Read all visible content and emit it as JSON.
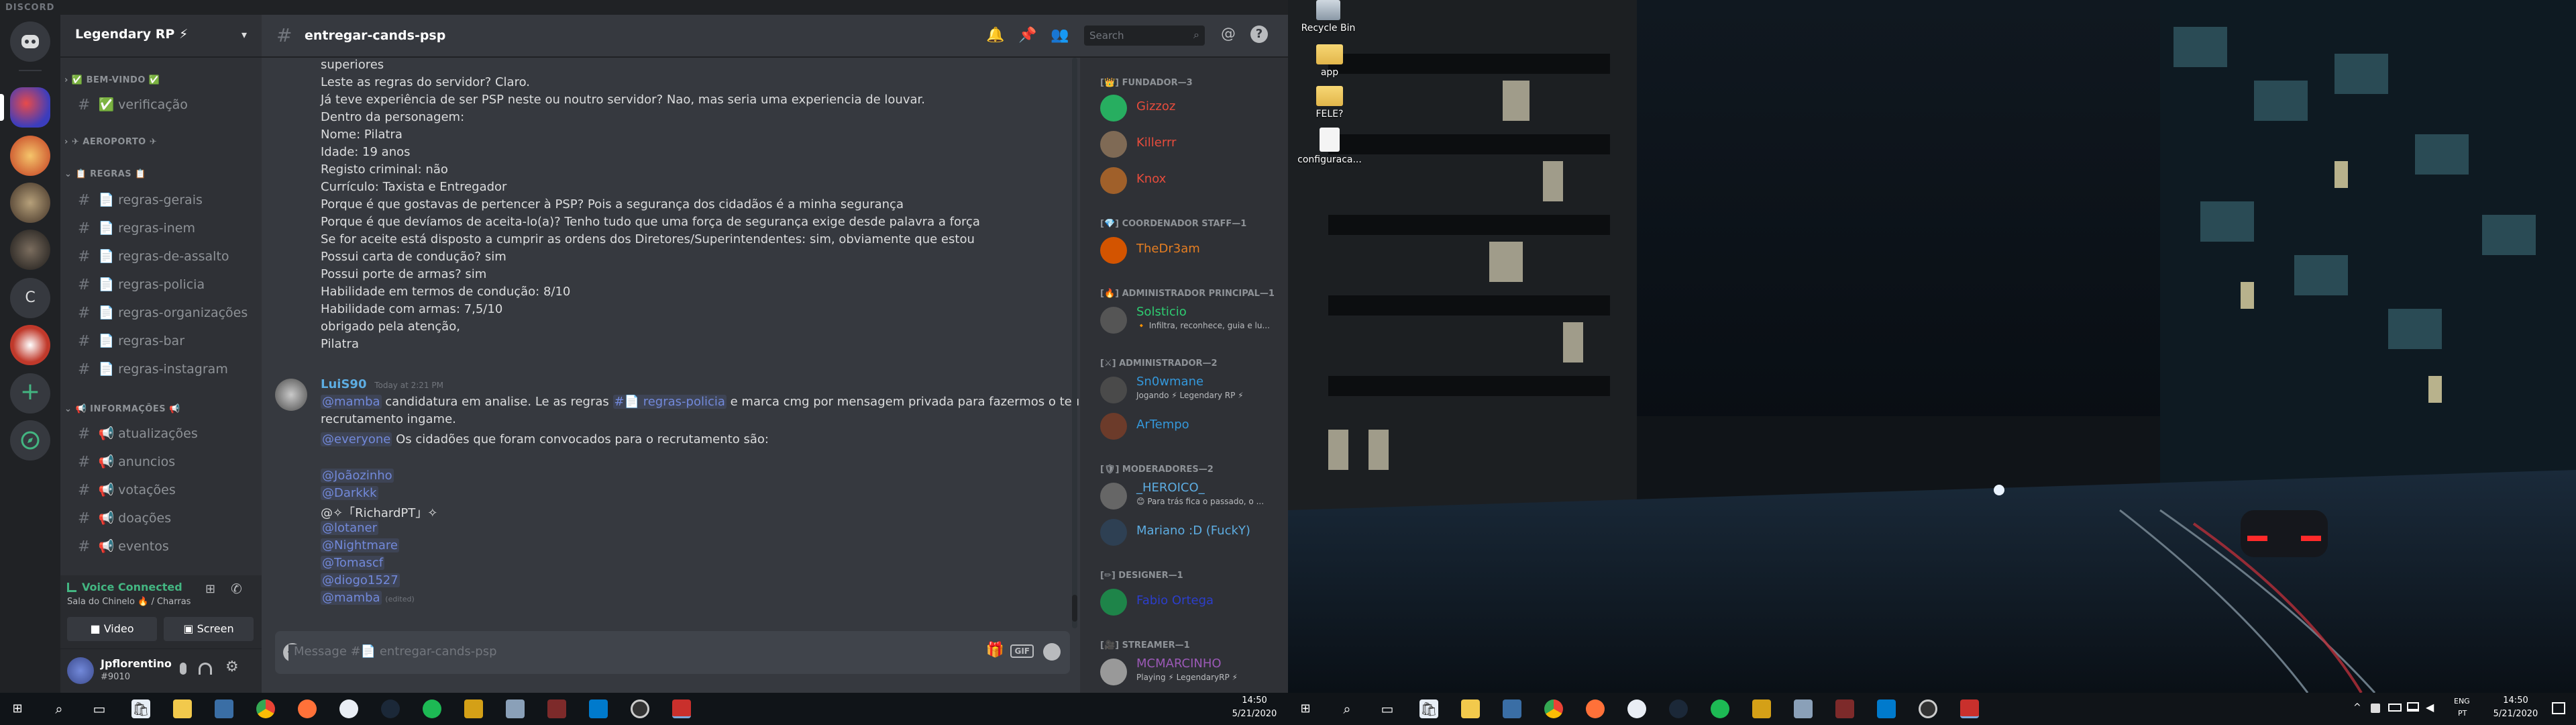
{
  "app": {
    "title": "DISCORD"
  },
  "server": {
    "name": "Legendary RP ⚡",
    "dropdown_icon": "chevron-down-icon"
  },
  "guild_letter": "C",
  "categories": [
    {
      "label": "✅ BEM-VINDO ✅"
    },
    {
      "label": "✈ AEROPORTO ✈"
    },
    {
      "label": "📋 REGRAS 📋"
    },
    {
      "label": "📢 INFORMAÇÕES 📢"
    }
  ],
  "channels": [
    {
      "label": "✅ verificação"
    },
    {
      "label": "📄 regras-gerais"
    },
    {
      "label": "📄 regras-inem"
    },
    {
      "label": "📄 regras-de-assalto"
    },
    {
      "label": "📄 regras-policia"
    },
    {
      "label": "📄 regras-organizações"
    },
    {
      "label": "📄 regras-bar"
    },
    {
      "label": "📄 regras-instagram"
    },
    {
      "label": "📢 atualizações"
    },
    {
      "label": "📢 anuncios"
    },
    {
      "label": "📢 votações"
    },
    {
      "label": "📢 doações"
    },
    {
      "label": "📢 eventos"
    }
  ],
  "voice": {
    "status": "Voice Connected",
    "location": "Sala do Chinelo 🔥 / Charras",
    "video_label": "Video",
    "screen_label": "Screen"
  },
  "user": {
    "name": "Jpflorentino",
    "tag": "#9010"
  },
  "chat": {
    "channel_name": "entregar-cands-psp",
    "search_placeholder": "Search",
    "composer_placeholder": "Message #📄 entregar-cands-psp"
  },
  "messages_prev": [
    "superiores",
    "Leste as regras do servidor? Claro.",
    "Já teve experiência de ser PSP neste ou noutro servidor? Nao, mas seria uma experiencia de louvar.",
    "Dentro da personagem:",
    "Nome: Pilatra",
    "Idade: 19 anos",
    "Registo criminal: não",
    "Currículo: Taxista e Entregador",
    "Porque é que gostavas de pertencer à PSP? Pois a segurança dos cidadãos é a minha segurança",
    "Porque é que devíamos de aceita-lo(a)? Tenho tudo que uma força de segurança exige desde palavra a força",
    "Se for aceite está disposto a cumprir as ordens dos Diretores/Superintendentes: sim, obviamente que estou",
    "Possui carta de condução? sim",
    "Possui porte de armas? sim",
    "Habilidade em termos de condução: 8/10",
    "Habilidade com armas: 7,5/10",
    "obrigado pela atenção,",
    "Pilatra"
  ],
  "message": {
    "author": "LuiS90",
    "timestamp": "Today at 2:21 PM",
    "line1_mention": "@mamba",
    "line1_a": " candidatura em analise. Le as regras ",
    "line1_channel": "#📄 regras-policia",
    "line1_b": " e marca cmg por mensagem privada para fazermos o teu",
    "line2": "recrutamento ingame.",
    "line3_mention": "@everyone",
    "line3": " Os cidadões que foram convocados para o recrutamento são:",
    "mentions": [
      "@Joãozinho",
      "@Darkkk",
      "@✧「RichardPT」✧",
      "@lotaner",
      "@Nightmare",
      "@Tomascf",
      "@diogo1527",
      "@mamba"
    ],
    "edited": "(edited)"
  },
  "members": {
    "roles": [
      {
        "label": "[👑] FUNDADOR—3"
      },
      {
        "label": "[💎] COORDENADOR STAFF—1"
      },
      {
        "label": "[🔥] ADMINISTRADOR PRINCIPAL—1"
      },
      {
        "label": "[⚔] ADMINISTRADOR—2"
      },
      {
        "label": "[🛡] MODERADORES—2"
      },
      {
        "label": "[✏] DESIGNER—1"
      },
      {
        "label": "[🎥] STREAMER—1"
      }
    ],
    "list": [
      {
        "name": "Gizzoz",
        "status": "",
        "color": "#e74c3c"
      },
      {
        "name": "Killerrr",
        "status": "",
        "color": "#e74c3c"
      },
      {
        "name": "Knox",
        "status": "",
        "color": "#e74c3c"
      },
      {
        "name": "TheDr3am",
        "status": "",
        "color": "#e67e22"
      },
      {
        "name": "Solsticio",
        "status": "🔸 Infiltra, reconhece, guia e lu...",
        "color": "#2ecc71"
      },
      {
        "name": "Sn0wmane",
        "status": "Jogando ⚡ Legendary RP ⚡",
        "color": "#3498db"
      },
      {
        "name": "ArTempo",
        "status": "",
        "color": "#3498db"
      },
      {
        "name": "_HEROICO_",
        "status": "😊 Para trás fica o passado, o ...",
        "color": "#5dade2"
      },
      {
        "name": "Mariano :D (FuckY)",
        "status": "",
        "color": "#5dade2"
      },
      {
        "name": "Fabio Ortega",
        "status": "",
        "color": "#2c3ecb"
      },
      {
        "name": "MCMARCINHO",
        "status": "Playing ⚡ LegendaryRP ⚡",
        "color": "#9b59b6"
      }
    ]
  },
  "taskbar1": {
    "time": "14:50",
    "date": "5/21/2020"
  },
  "taskbar2": {
    "lang1": "ENG",
    "lang2": "PT",
    "time": "14:50",
    "date": "5/21/2020"
  },
  "desktop": {
    "icons": [
      {
        "label": "Recycle Bin"
      },
      {
        "label": "app"
      },
      {
        "label": "FELE?"
      },
      {
        "label": "configuraca..."
      }
    ]
  },
  "colors": {
    "blurple": "#7289da",
    "online": "#43b581",
    "bg": "#36393f"
  }
}
